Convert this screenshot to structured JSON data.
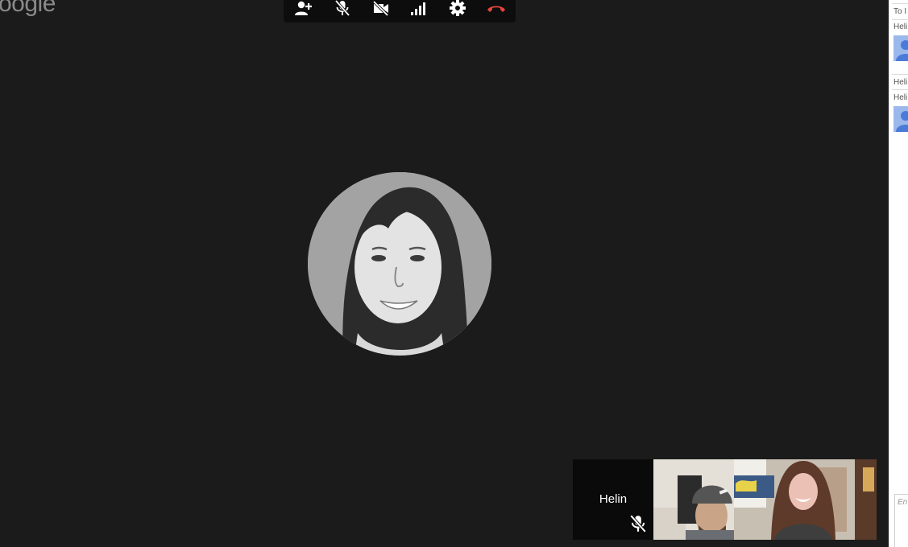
{
  "app": {
    "logo_text": "oogle"
  },
  "toolbar": {
    "buttons": [
      {
        "name": "add-people",
        "icon": "add-person-icon"
      },
      {
        "name": "microphone",
        "icon": "mic-off-icon"
      },
      {
        "name": "camera",
        "icon": "video-off-icon"
      },
      {
        "name": "bandwidth",
        "icon": "signal-bars-icon"
      },
      {
        "name": "settings",
        "icon": "gear-icon"
      },
      {
        "name": "hang-up",
        "icon": "phone-hangup-icon",
        "color": "#e8453c"
      }
    ]
  },
  "main_stage": {
    "speaker_avatar": "speaker-photo"
  },
  "filmstrip": {
    "tiles": [
      {
        "name": "Helin",
        "muted": true
      },
      {
        "name": "",
        "image": "participant-video-man-beanie"
      },
      {
        "name": "",
        "image": "participant-video-woman"
      }
    ]
  },
  "side_panel": {
    "to_text": "To I",
    "messages": [
      {
        "sender": "Heli"
      },
      {
        "sender": "Heli"
      },
      {
        "sender": "Heli"
      }
    ],
    "input_placeholder": "En"
  },
  "colors": {
    "background": "#1b1b1b",
    "toolbar": "#0d0d0d",
    "hangup": "#e8453c",
    "avatar_blue": "#9bb8ec"
  }
}
